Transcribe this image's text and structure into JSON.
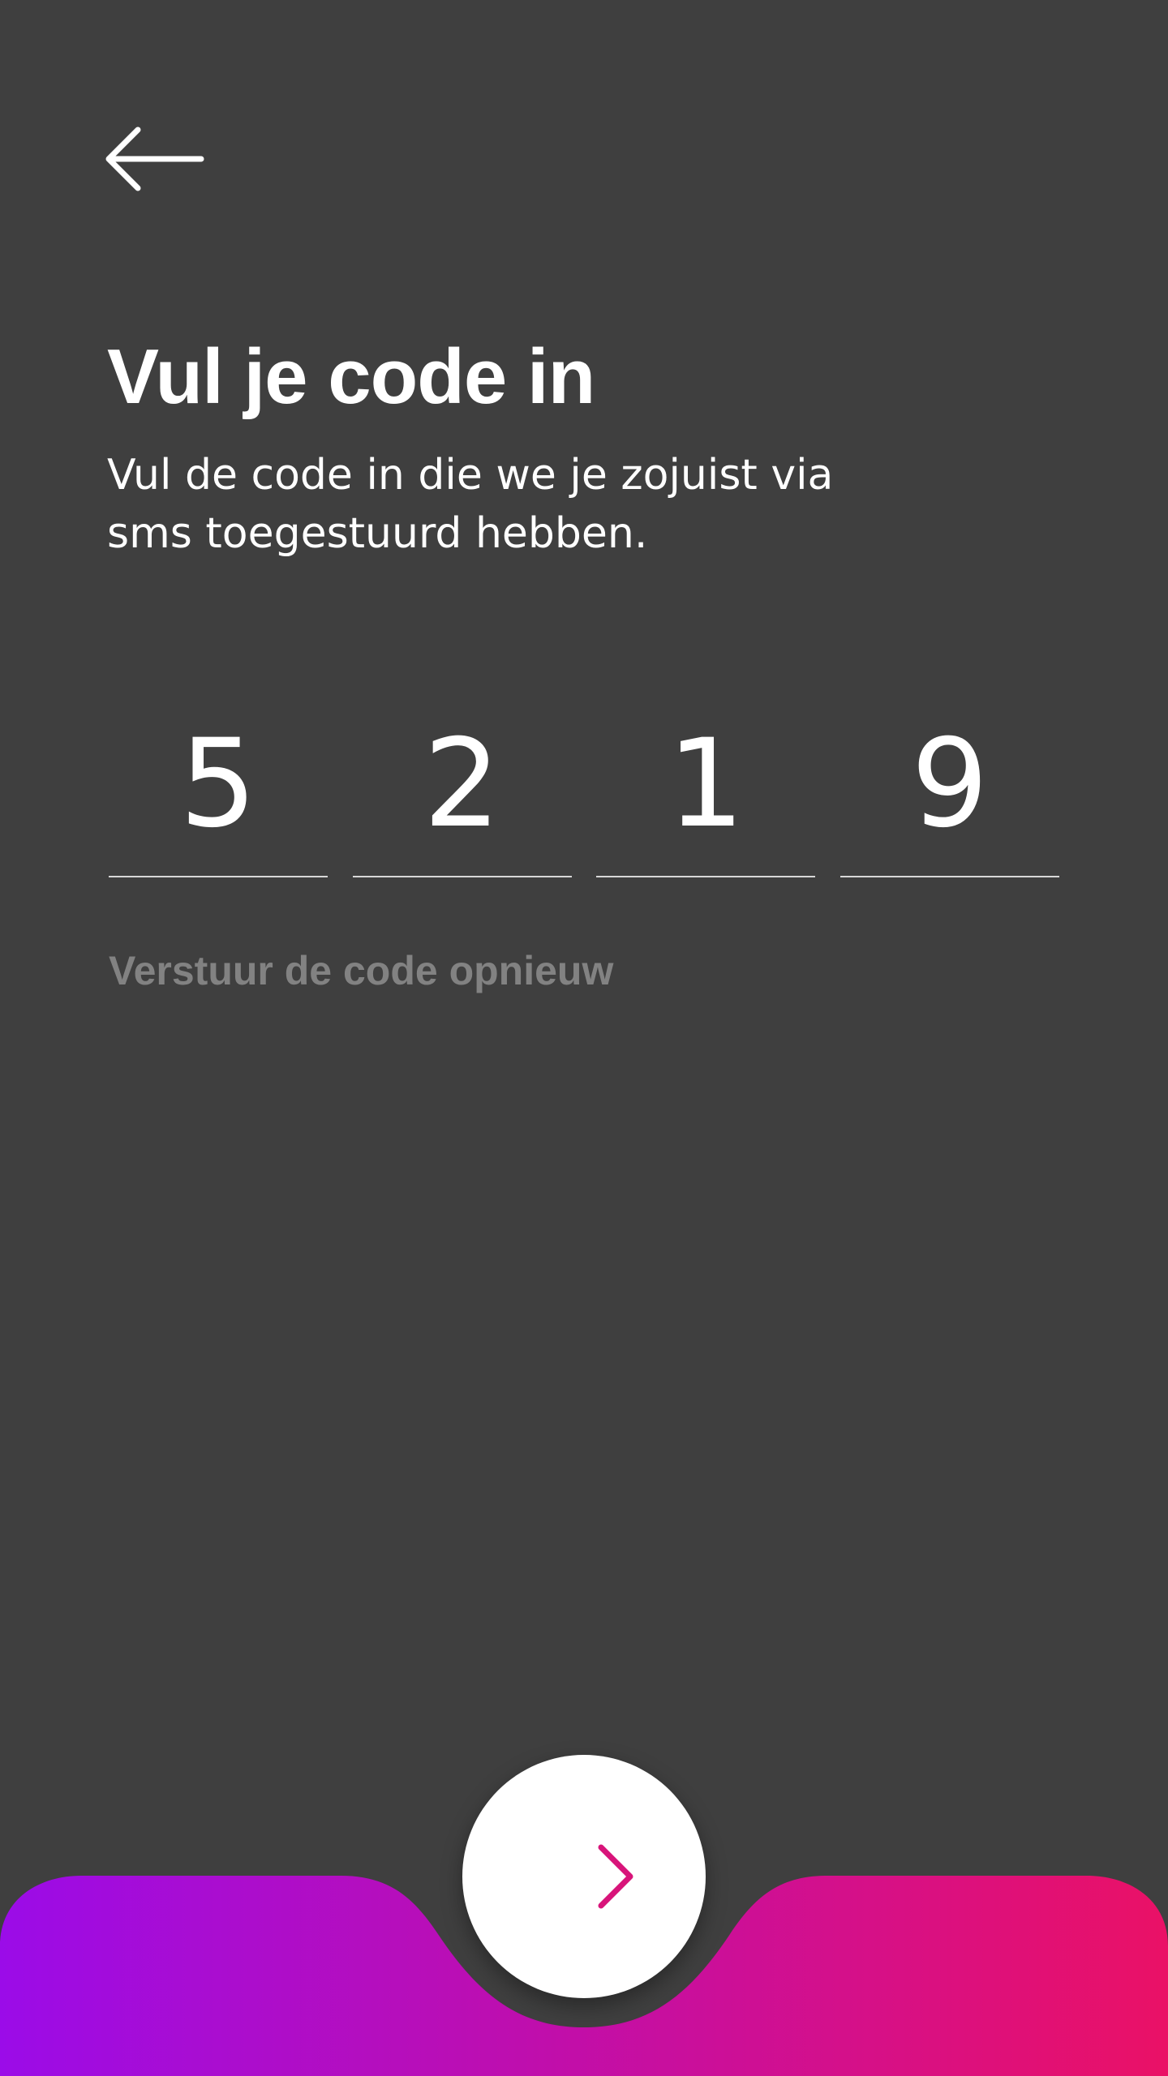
{
  "header": {
    "back_icon": "arrow-left-icon"
  },
  "main": {
    "title": "Vul je code in",
    "subtitle": "Vul de code in die we je zojuist via sms toegestuurd hebben.",
    "code_digits": [
      "5",
      "2",
      "1",
      "9"
    ],
    "resend_label": "Verstuur de code opnieuw"
  },
  "footer": {
    "next_icon": "arrow-right-icon",
    "gradient_start": "#9b0ce8",
    "gradient_end": "#ea1166"
  },
  "colors": {
    "background": "#3f3f3f",
    "text": "#ffffff",
    "muted_text": "#828282",
    "underline": "#d8d8d8"
  }
}
